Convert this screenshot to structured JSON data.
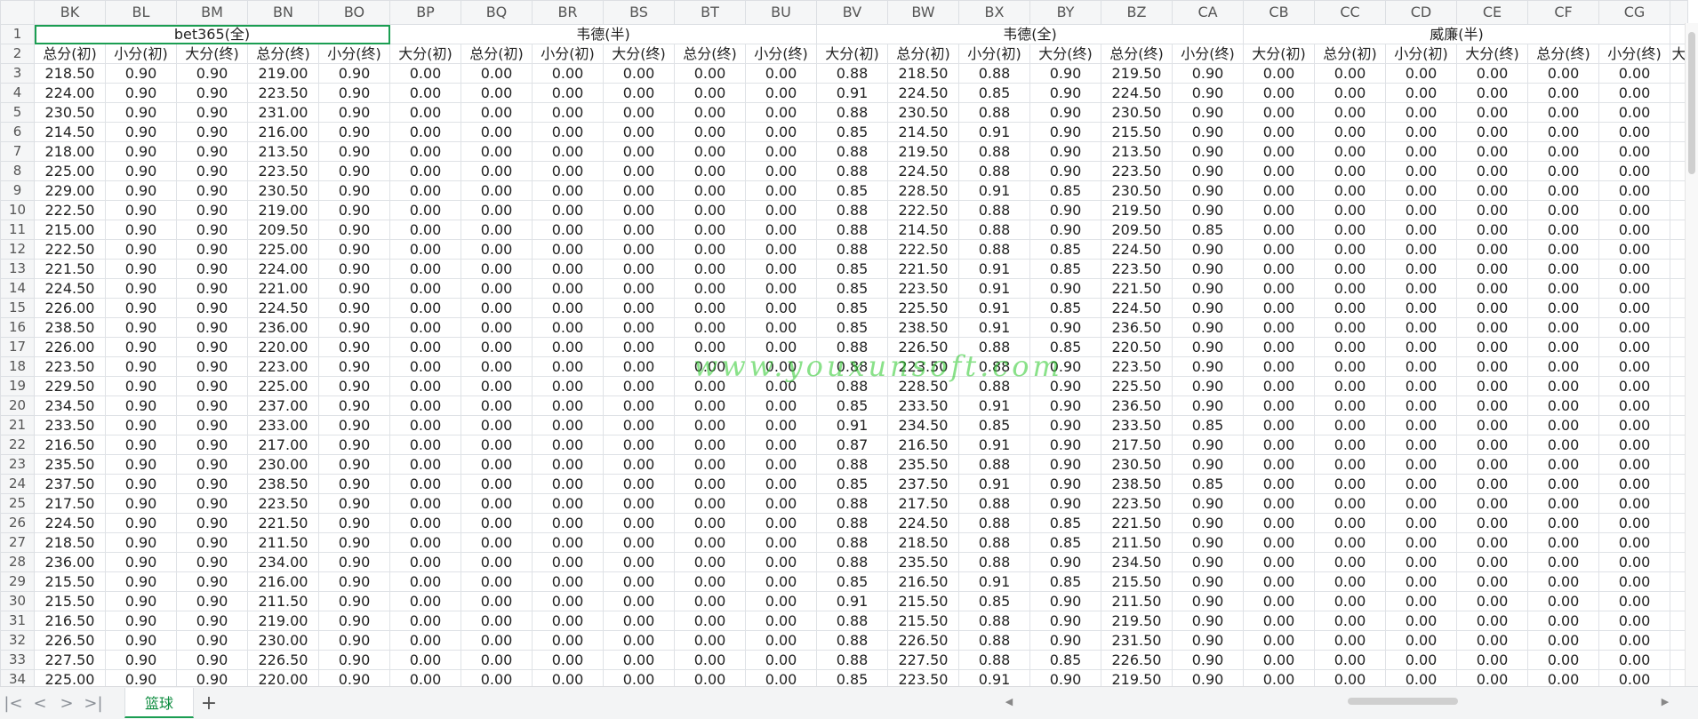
{
  "window": {
    "sheet_tab": "篮球",
    "add_tab_label": "+"
  },
  "nav": {
    "first": "|<",
    "prev": "<",
    "next": ">",
    "last": ">|"
  },
  "columns": [
    "BK",
    "BL",
    "BM",
    "BN",
    "BO",
    "BP",
    "BQ",
    "BR",
    "BS",
    "BT",
    "BU",
    "BV",
    "BW",
    "BX",
    "BY",
    "BZ",
    "CA",
    "CB",
    "CC",
    "CD",
    "CE",
    "CF",
    "CG"
  ],
  "row1_groups": [
    {
      "label": "bet365(全)",
      "span": 5
    },
    {
      "label": "韦德(半)",
      "span": 6
    },
    {
      "label": "韦德(全)",
      "span": 6
    },
    {
      "label": "威廉(半)",
      "span": 6
    }
  ],
  "row2_headers": [
    "总分(初)",
    "小分(初)",
    "大分(终)",
    "总分(终)",
    "小分(终)",
    "大分(初)",
    "总分(初)",
    "小分(初)",
    "大分(终)",
    "总分(终)",
    "小分(终)",
    "大分(初)",
    "总分(初)",
    "小分(初)",
    "大分(终)",
    "总分(终)",
    "小分(终)",
    "大分(初)",
    "总分(初)",
    "小分(初)",
    "大分(终)",
    "总分(终)",
    "小分(终)"
  ],
  "trailing_header": "大",
  "rows": [
    {
      "n": "3",
      "v": [
        "218.50",
        "0.90",
        "0.90",
        "219.00",
        "0.90",
        "0.00",
        "0.00",
        "0.00",
        "0.00",
        "0.00",
        "0.00",
        "0.88",
        "218.50",
        "0.88",
        "0.90",
        "219.50",
        "0.90",
        "0.00",
        "0.00",
        "0.00",
        "0.00",
        "0.00",
        "0.00"
      ]
    },
    {
      "n": "4",
      "v": [
        "224.00",
        "0.90",
        "0.90",
        "223.50",
        "0.90",
        "0.00",
        "0.00",
        "0.00",
        "0.00",
        "0.00",
        "0.00",
        "0.91",
        "224.50",
        "0.85",
        "0.90",
        "224.50",
        "0.90",
        "0.00",
        "0.00",
        "0.00",
        "0.00",
        "0.00",
        "0.00"
      ]
    },
    {
      "n": "5",
      "v": [
        "230.50",
        "0.90",
        "0.90",
        "231.00",
        "0.90",
        "0.00",
        "0.00",
        "0.00",
        "0.00",
        "0.00",
        "0.00",
        "0.88",
        "230.50",
        "0.88",
        "0.90",
        "230.50",
        "0.90",
        "0.00",
        "0.00",
        "0.00",
        "0.00",
        "0.00",
        "0.00"
      ]
    },
    {
      "n": "6",
      "v": [
        "214.50",
        "0.90",
        "0.90",
        "216.00",
        "0.90",
        "0.00",
        "0.00",
        "0.00",
        "0.00",
        "0.00",
        "0.00",
        "0.85",
        "214.50",
        "0.91",
        "0.90",
        "215.50",
        "0.90",
        "0.00",
        "0.00",
        "0.00",
        "0.00",
        "0.00",
        "0.00"
      ]
    },
    {
      "n": "7",
      "v": [
        "218.00",
        "0.90",
        "0.90",
        "213.50",
        "0.90",
        "0.00",
        "0.00",
        "0.00",
        "0.00",
        "0.00",
        "0.00",
        "0.88",
        "219.50",
        "0.88",
        "0.90",
        "213.50",
        "0.90",
        "0.00",
        "0.00",
        "0.00",
        "0.00",
        "0.00",
        "0.00"
      ]
    },
    {
      "n": "8",
      "v": [
        "225.00",
        "0.90",
        "0.90",
        "223.50",
        "0.90",
        "0.00",
        "0.00",
        "0.00",
        "0.00",
        "0.00",
        "0.00",
        "0.88",
        "224.50",
        "0.88",
        "0.90",
        "223.50",
        "0.90",
        "0.00",
        "0.00",
        "0.00",
        "0.00",
        "0.00",
        "0.00"
      ]
    },
    {
      "n": "9",
      "v": [
        "229.00",
        "0.90",
        "0.90",
        "230.50",
        "0.90",
        "0.00",
        "0.00",
        "0.00",
        "0.00",
        "0.00",
        "0.00",
        "0.85",
        "228.50",
        "0.91",
        "0.85",
        "230.50",
        "0.90",
        "0.00",
        "0.00",
        "0.00",
        "0.00",
        "0.00",
        "0.00"
      ]
    },
    {
      "n": "10",
      "v": [
        "222.50",
        "0.90",
        "0.90",
        "219.00",
        "0.90",
        "0.00",
        "0.00",
        "0.00",
        "0.00",
        "0.00",
        "0.00",
        "0.88",
        "222.50",
        "0.88",
        "0.90",
        "219.50",
        "0.90",
        "0.00",
        "0.00",
        "0.00",
        "0.00",
        "0.00",
        "0.00"
      ]
    },
    {
      "n": "11",
      "v": [
        "215.00",
        "0.90",
        "0.90",
        "209.50",
        "0.90",
        "0.00",
        "0.00",
        "0.00",
        "0.00",
        "0.00",
        "0.00",
        "0.88",
        "214.50",
        "0.88",
        "0.90",
        "209.50",
        "0.85",
        "0.00",
        "0.00",
        "0.00",
        "0.00",
        "0.00",
        "0.00"
      ]
    },
    {
      "n": "12",
      "v": [
        "222.50",
        "0.90",
        "0.90",
        "225.00",
        "0.90",
        "0.00",
        "0.00",
        "0.00",
        "0.00",
        "0.00",
        "0.00",
        "0.88",
        "222.50",
        "0.88",
        "0.85",
        "224.50",
        "0.90",
        "0.00",
        "0.00",
        "0.00",
        "0.00",
        "0.00",
        "0.00"
      ]
    },
    {
      "n": "13",
      "v": [
        "221.50",
        "0.90",
        "0.90",
        "224.00",
        "0.90",
        "0.00",
        "0.00",
        "0.00",
        "0.00",
        "0.00",
        "0.00",
        "0.85",
        "221.50",
        "0.91",
        "0.85",
        "223.50",
        "0.90",
        "0.00",
        "0.00",
        "0.00",
        "0.00",
        "0.00",
        "0.00"
      ]
    },
    {
      "n": "14",
      "v": [
        "224.50",
        "0.90",
        "0.90",
        "221.00",
        "0.90",
        "0.00",
        "0.00",
        "0.00",
        "0.00",
        "0.00",
        "0.00",
        "0.85",
        "223.50",
        "0.91",
        "0.90",
        "221.50",
        "0.90",
        "0.00",
        "0.00",
        "0.00",
        "0.00",
        "0.00",
        "0.00"
      ]
    },
    {
      "n": "15",
      "v": [
        "226.00",
        "0.90",
        "0.90",
        "224.50",
        "0.90",
        "0.00",
        "0.00",
        "0.00",
        "0.00",
        "0.00",
        "0.00",
        "0.85",
        "225.50",
        "0.91",
        "0.85",
        "224.50",
        "0.90",
        "0.00",
        "0.00",
        "0.00",
        "0.00",
        "0.00",
        "0.00"
      ]
    },
    {
      "n": "16",
      "v": [
        "238.50",
        "0.90",
        "0.90",
        "236.00",
        "0.90",
        "0.00",
        "0.00",
        "0.00",
        "0.00",
        "0.00",
        "0.00",
        "0.85",
        "238.50",
        "0.91",
        "0.90",
        "236.50",
        "0.90",
        "0.00",
        "0.00",
        "0.00",
        "0.00",
        "0.00",
        "0.00"
      ]
    },
    {
      "n": "17",
      "v": [
        "226.00",
        "0.90",
        "0.90",
        "220.00",
        "0.90",
        "0.00",
        "0.00",
        "0.00",
        "0.00",
        "0.00",
        "0.00",
        "0.88",
        "226.50",
        "0.88",
        "0.85",
        "220.50",
        "0.90",
        "0.00",
        "0.00",
        "0.00",
        "0.00",
        "0.00",
        "0.00"
      ]
    },
    {
      "n": "18",
      "v": [
        "223.50",
        "0.90",
        "0.90",
        "223.00",
        "0.90",
        "0.00",
        "0.00",
        "0.00",
        "0.00",
        "0.00",
        "0.00",
        "0.88",
        "223.50",
        "0.88",
        "0.90",
        "223.50",
        "0.90",
        "0.00",
        "0.00",
        "0.00",
        "0.00",
        "0.00",
        "0.00"
      ]
    },
    {
      "n": "19",
      "v": [
        "229.50",
        "0.90",
        "0.90",
        "225.00",
        "0.90",
        "0.00",
        "0.00",
        "0.00",
        "0.00",
        "0.00",
        "0.00",
        "0.88",
        "228.50",
        "0.88",
        "0.90",
        "225.50",
        "0.90",
        "0.00",
        "0.00",
        "0.00",
        "0.00",
        "0.00",
        "0.00"
      ]
    },
    {
      "n": "20",
      "v": [
        "234.50",
        "0.90",
        "0.90",
        "237.00",
        "0.90",
        "0.00",
        "0.00",
        "0.00",
        "0.00",
        "0.00",
        "0.00",
        "0.85",
        "233.50",
        "0.91",
        "0.90",
        "236.50",
        "0.90",
        "0.00",
        "0.00",
        "0.00",
        "0.00",
        "0.00",
        "0.00"
      ]
    },
    {
      "n": "21",
      "v": [
        "233.50",
        "0.90",
        "0.90",
        "233.00",
        "0.90",
        "0.00",
        "0.00",
        "0.00",
        "0.00",
        "0.00",
        "0.00",
        "0.91",
        "234.50",
        "0.85",
        "0.90",
        "233.50",
        "0.85",
        "0.00",
        "0.00",
        "0.00",
        "0.00",
        "0.00",
        "0.00"
      ]
    },
    {
      "n": "22",
      "v": [
        "216.50",
        "0.90",
        "0.90",
        "217.00",
        "0.90",
        "0.00",
        "0.00",
        "0.00",
        "0.00",
        "0.00",
        "0.00",
        "0.87",
        "216.50",
        "0.91",
        "0.90",
        "217.50",
        "0.90",
        "0.00",
        "0.00",
        "0.00",
        "0.00",
        "0.00",
        "0.00"
      ]
    },
    {
      "n": "23",
      "v": [
        "235.50",
        "0.90",
        "0.90",
        "230.00",
        "0.90",
        "0.00",
        "0.00",
        "0.00",
        "0.00",
        "0.00",
        "0.00",
        "0.88",
        "235.50",
        "0.88",
        "0.90",
        "230.50",
        "0.90",
        "0.00",
        "0.00",
        "0.00",
        "0.00",
        "0.00",
        "0.00"
      ]
    },
    {
      "n": "24",
      "v": [
        "237.50",
        "0.90",
        "0.90",
        "238.50",
        "0.90",
        "0.00",
        "0.00",
        "0.00",
        "0.00",
        "0.00",
        "0.00",
        "0.85",
        "237.50",
        "0.91",
        "0.90",
        "238.50",
        "0.85",
        "0.00",
        "0.00",
        "0.00",
        "0.00",
        "0.00",
        "0.00"
      ]
    },
    {
      "n": "25",
      "v": [
        "217.50",
        "0.90",
        "0.90",
        "223.50",
        "0.90",
        "0.00",
        "0.00",
        "0.00",
        "0.00",
        "0.00",
        "0.00",
        "0.88",
        "217.50",
        "0.88",
        "0.90",
        "223.50",
        "0.90",
        "0.00",
        "0.00",
        "0.00",
        "0.00",
        "0.00",
        "0.00"
      ]
    },
    {
      "n": "26",
      "v": [
        "224.50",
        "0.90",
        "0.90",
        "221.50",
        "0.90",
        "0.00",
        "0.00",
        "0.00",
        "0.00",
        "0.00",
        "0.00",
        "0.88",
        "224.50",
        "0.88",
        "0.85",
        "221.50",
        "0.90",
        "0.00",
        "0.00",
        "0.00",
        "0.00",
        "0.00",
        "0.00"
      ]
    },
    {
      "n": "27",
      "v": [
        "218.50",
        "0.90",
        "0.90",
        "211.50",
        "0.90",
        "0.00",
        "0.00",
        "0.00",
        "0.00",
        "0.00",
        "0.00",
        "0.88",
        "218.50",
        "0.88",
        "0.85",
        "211.50",
        "0.90",
        "0.00",
        "0.00",
        "0.00",
        "0.00",
        "0.00",
        "0.00"
      ]
    },
    {
      "n": "28",
      "v": [
        "236.00",
        "0.90",
        "0.90",
        "234.00",
        "0.90",
        "0.00",
        "0.00",
        "0.00",
        "0.00",
        "0.00",
        "0.00",
        "0.88",
        "235.50",
        "0.88",
        "0.90",
        "234.50",
        "0.90",
        "0.00",
        "0.00",
        "0.00",
        "0.00",
        "0.00",
        "0.00"
      ]
    },
    {
      "n": "29",
      "v": [
        "215.50",
        "0.90",
        "0.90",
        "216.00",
        "0.90",
        "0.00",
        "0.00",
        "0.00",
        "0.00",
        "0.00",
        "0.00",
        "0.85",
        "216.50",
        "0.91",
        "0.85",
        "215.50",
        "0.90",
        "0.00",
        "0.00",
        "0.00",
        "0.00",
        "0.00",
        "0.00"
      ]
    },
    {
      "n": "30",
      "v": [
        "215.50",
        "0.90",
        "0.90",
        "211.50",
        "0.90",
        "0.00",
        "0.00",
        "0.00",
        "0.00",
        "0.00",
        "0.00",
        "0.91",
        "215.50",
        "0.85",
        "0.90",
        "211.50",
        "0.90",
        "0.00",
        "0.00",
        "0.00",
        "0.00",
        "0.00",
        "0.00"
      ]
    },
    {
      "n": "31",
      "v": [
        "216.50",
        "0.90",
        "0.90",
        "219.00",
        "0.90",
        "0.00",
        "0.00",
        "0.00",
        "0.00",
        "0.00",
        "0.00",
        "0.88",
        "215.50",
        "0.88",
        "0.90",
        "219.50",
        "0.90",
        "0.00",
        "0.00",
        "0.00",
        "0.00",
        "0.00",
        "0.00"
      ]
    },
    {
      "n": "32",
      "v": [
        "226.50",
        "0.90",
        "0.90",
        "230.00",
        "0.90",
        "0.00",
        "0.00",
        "0.00",
        "0.00",
        "0.00",
        "0.00",
        "0.88",
        "226.50",
        "0.88",
        "0.90",
        "231.50",
        "0.90",
        "0.00",
        "0.00",
        "0.00",
        "0.00",
        "0.00",
        "0.00"
      ]
    },
    {
      "n": "33",
      "v": [
        "227.50",
        "0.90",
        "0.90",
        "226.50",
        "0.90",
        "0.00",
        "0.00",
        "0.00",
        "0.00",
        "0.00",
        "0.00",
        "0.88",
        "227.50",
        "0.88",
        "0.85",
        "226.50",
        "0.90",
        "0.00",
        "0.00",
        "0.00",
        "0.00",
        "0.00",
        "0.00"
      ]
    },
    {
      "n": "34",
      "v": [
        "225.00",
        "0.90",
        "0.90",
        "220.00",
        "0.90",
        "0.00",
        "0.00",
        "0.00",
        "0.00",
        "0.00",
        "0.00",
        "0.85",
        "223.50",
        "0.91",
        "0.90",
        "219.50",
        "0.90",
        "0.00",
        "0.00",
        "0.00",
        "0.00",
        "0.00",
        "0.00"
      ]
    }
  ],
  "watermark": "www.youxunsoft.com",
  "colors": {
    "accent": "#1b9e52",
    "tab_text": "#0a8a3c",
    "grid": "#dfe2e6",
    "header_bg": "#f5f6f7",
    "watermark": "#28c828"
  },
  "icons": {
    "first_sheet": "first-sheet-icon",
    "prev_sheet": "prev-sheet-icon",
    "next_sheet": "next-sheet-icon",
    "last_sheet": "last-sheet-icon",
    "add_sheet": "plus-icon"
  }
}
